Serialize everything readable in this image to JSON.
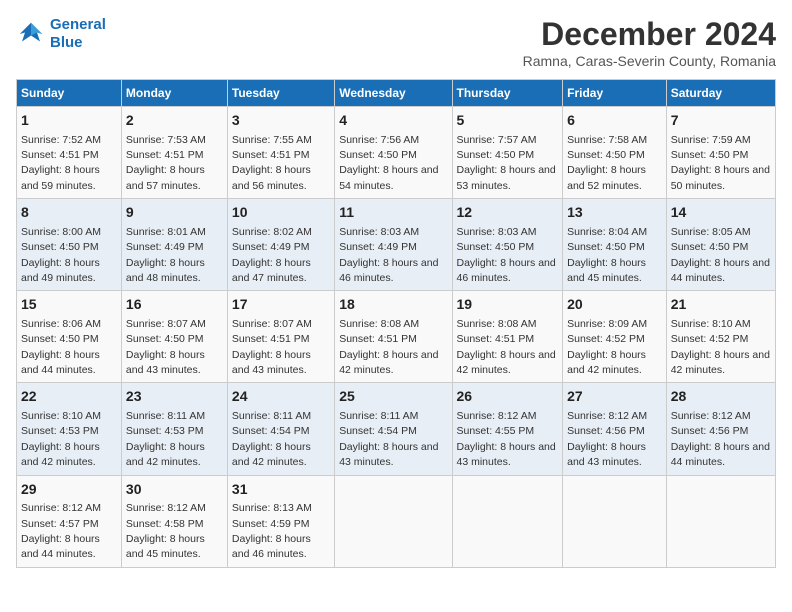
{
  "header": {
    "logo_line1": "General",
    "logo_line2": "Blue",
    "month_title": "December 2024",
    "location": "Ramna, Caras-Severin County, Romania"
  },
  "days_of_week": [
    "Sunday",
    "Monday",
    "Tuesday",
    "Wednesday",
    "Thursday",
    "Friday",
    "Saturday"
  ],
  "weeks": [
    [
      {
        "day": "1",
        "sunrise": "7:52 AM",
        "sunset": "4:51 PM",
        "daylight": "8 hours and 59 minutes."
      },
      {
        "day": "2",
        "sunrise": "7:53 AM",
        "sunset": "4:51 PM",
        "daylight": "8 hours and 57 minutes."
      },
      {
        "day": "3",
        "sunrise": "7:55 AM",
        "sunset": "4:51 PM",
        "daylight": "8 hours and 56 minutes."
      },
      {
        "day": "4",
        "sunrise": "7:56 AM",
        "sunset": "4:50 PM",
        "daylight": "8 hours and 54 minutes."
      },
      {
        "day": "5",
        "sunrise": "7:57 AM",
        "sunset": "4:50 PM",
        "daylight": "8 hours and 53 minutes."
      },
      {
        "day": "6",
        "sunrise": "7:58 AM",
        "sunset": "4:50 PM",
        "daylight": "8 hours and 52 minutes."
      },
      {
        "day": "7",
        "sunrise": "7:59 AM",
        "sunset": "4:50 PM",
        "daylight": "8 hours and 50 minutes."
      }
    ],
    [
      {
        "day": "8",
        "sunrise": "8:00 AM",
        "sunset": "4:50 PM",
        "daylight": "8 hours and 49 minutes."
      },
      {
        "day": "9",
        "sunrise": "8:01 AM",
        "sunset": "4:49 PM",
        "daylight": "8 hours and 48 minutes."
      },
      {
        "day": "10",
        "sunrise": "8:02 AM",
        "sunset": "4:49 PM",
        "daylight": "8 hours and 47 minutes."
      },
      {
        "day": "11",
        "sunrise": "8:03 AM",
        "sunset": "4:49 PM",
        "daylight": "8 hours and 46 minutes."
      },
      {
        "day": "12",
        "sunrise": "8:03 AM",
        "sunset": "4:50 PM",
        "daylight": "8 hours and 46 minutes."
      },
      {
        "day": "13",
        "sunrise": "8:04 AM",
        "sunset": "4:50 PM",
        "daylight": "8 hours and 45 minutes."
      },
      {
        "day": "14",
        "sunrise": "8:05 AM",
        "sunset": "4:50 PM",
        "daylight": "8 hours and 44 minutes."
      }
    ],
    [
      {
        "day": "15",
        "sunrise": "8:06 AM",
        "sunset": "4:50 PM",
        "daylight": "8 hours and 44 minutes."
      },
      {
        "day": "16",
        "sunrise": "8:07 AM",
        "sunset": "4:50 PM",
        "daylight": "8 hours and 43 minutes."
      },
      {
        "day": "17",
        "sunrise": "8:07 AM",
        "sunset": "4:51 PM",
        "daylight": "8 hours and 43 minutes."
      },
      {
        "day": "18",
        "sunrise": "8:08 AM",
        "sunset": "4:51 PM",
        "daylight": "8 hours and 42 minutes."
      },
      {
        "day": "19",
        "sunrise": "8:08 AM",
        "sunset": "4:51 PM",
        "daylight": "8 hours and 42 minutes."
      },
      {
        "day": "20",
        "sunrise": "8:09 AM",
        "sunset": "4:52 PM",
        "daylight": "8 hours and 42 minutes."
      },
      {
        "day": "21",
        "sunrise": "8:10 AM",
        "sunset": "4:52 PM",
        "daylight": "8 hours and 42 minutes."
      }
    ],
    [
      {
        "day": "22",
        "sunrise": "8:10 AM",
        "sunset": "4:53 PM",
        "daylight": "8 hours and 42 minutes."
      },
      {
        "day": "23",
        "sunrise": "8:11 AM",
        "sunset": "4:53 PM",
        "daylight": "8 hours and 42 minutes."
      },
      {
        "day": "24",
        "sunrise": "8:11 AM",
        "sunset": "4:54 PM",
        "daylight": "8 hours and 42 minutes."
      },
      {
        "day": "25",
        "sunrise": "8:11 AM",
        "sunset": "4:54 PM",
        "daylight": "8 hours and 43 minutes."
      },
      {
        "day": "26",
        "sunrise": "8:12 AM",
        "sunset": "4:55 PM",
        "daylight": "8 hours and 43 minutes."
      },
      {
        "day": "27",
        "sunrise": "8:12 AM",
        "sunset": "4:56 PM",
        "daylight": "8 hours and 43 minutes."
      },
      {
        "day": "28",
        "sunrise": "8:12 AM",
        "sunset": "4:56 PM",
        "daylight": "8 hours and 44 minutes."
      }
    ],
    [
      {
        "day": "29",
        "sunrise": "8:12 AM",
        "sunset": "4:57 PM",
        "daylight": "8 hours and 44 minutes."
      },
      {
        "day": "30",
        "sunrise": "8:12 AM",
        "sunset": "4:58 PM",
        "daylight": "8 hours and 45 minutes."
      },
      {
        "day": "31",
        "sunrise": "8:13 AM",
        "sunset": "4:59 PM",
        "daylight": "8 hours and 46 minutes."
      },
      null,
      null,
      null,
      null
    ]
  ]
}
